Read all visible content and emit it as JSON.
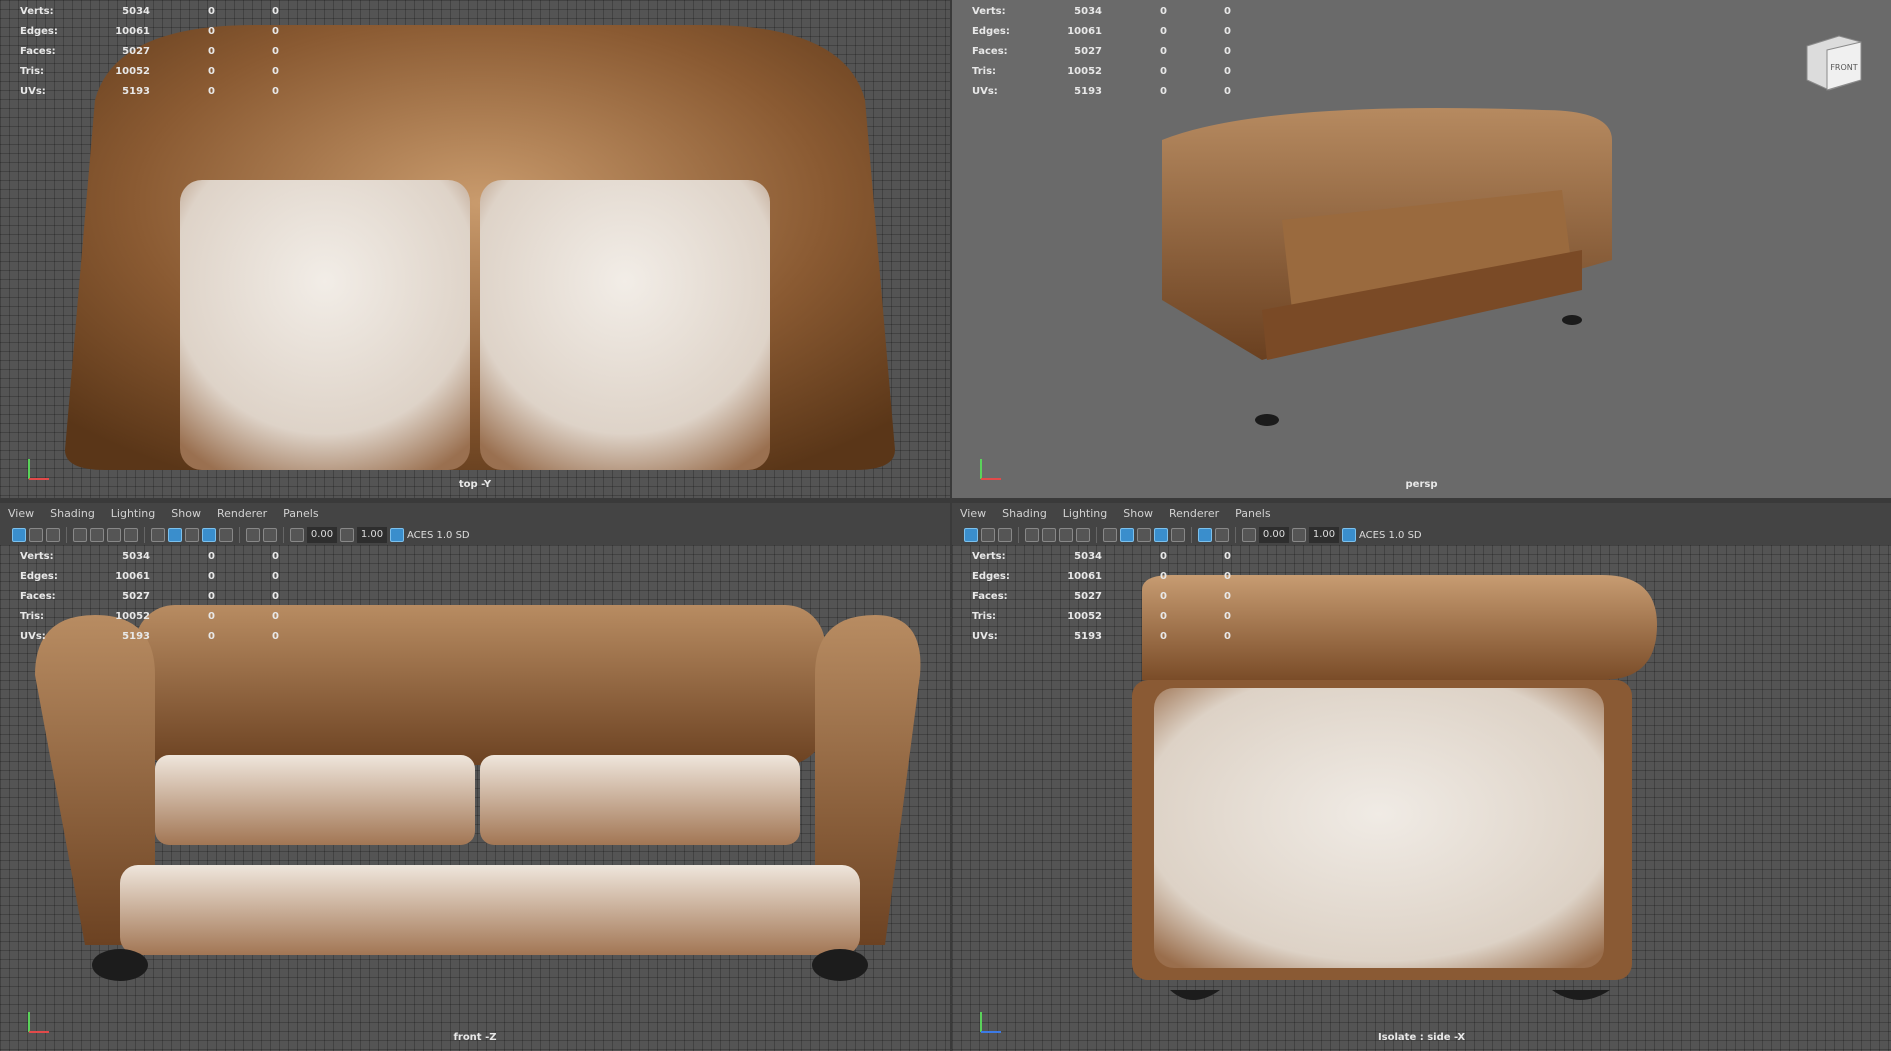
{
  "stats": {
    "rows": [
      {
        "label": "Verts:",
        "v1": "5034",
        "v2": "0",
        "v3": "0"
      },
      {
        "label": "Edges:",
        "v1": "10061",
        "v2": "0",
        "v3": "0"
      },
      {
        "label": "Faces:",
        "v1": "5027",
        "v2": "0",
        "v3": "0"
      },
      {
        "label": "Tris:",
        "v1": "10052",
        "v2": "0",
        "v3": "0"
      },
      {
        "label": "UVs:",
        "v1": "5193",
        "v2": "0",
        "v3": "0"
      }
    ]
  },
  "viewports": {
    "top": {
      "label": "top -Y"
    },
    "persp": {
      "label": "persp"
    },
    "front": {
      "label": "front -Z"
    },
    "side": {
      "label": "Isolate : side -X"
    }
  },
  "menu": {
    "items": [
      "View",
      "Shading",
      "Lighting",
      "Show",
      "Renderer",
      "Panels"
    ]
  },
  "toolbar": {
    "value_a": "0.00",
    "value_b": "1.00",
    "colorspace": "ACES 1.0 SD"
  },
  "viewcube": {
    "face": "FRONT"
  },
  "colors": {
    "leather": "#8a5a32",
    "cushion": "#e6dcd2",
    "viewport_bg": "#545454",
    "persp_bg": "#6a6a6a"
  }
}
